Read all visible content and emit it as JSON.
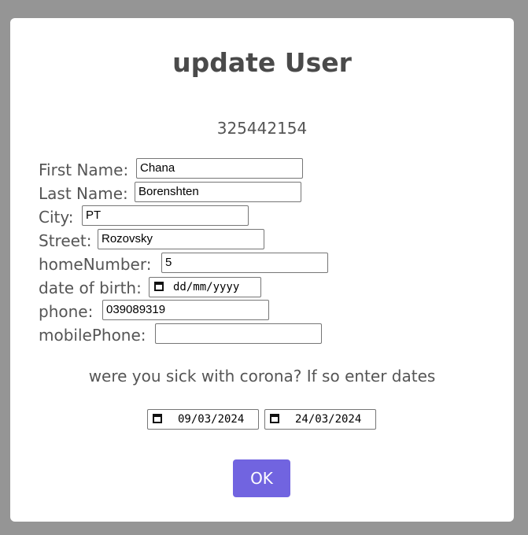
{
  "dialog": {
    "title": "update User",
    "user_id": "325442154",
    "fields": [
      {
        "label": "First Name:",
        "value": "Chana"
      },
      {
        "label": "Last Name:",
        "value": "Borenshten"
      },
      {
        "label": "City:",
        "value": "PT"
      },
      {
        "label": "Street:",
        "value": "Rozovsky"
      },
      {
        "label": "homeNumber:",
        "value": "5"
      },
      {
        "label": "date of birth:",
        "value": "dd/mm/yyyy"
      },
      {
        "label": "phone:",
        "value": "039089319"
      },
      {
        "label": "mobilePhone:",
        "value": ""
      }
    ],
    "corona_question": "were you sick with corona? If so enter dates",
    "corona_dates": {
      "from": "09/03/2024",
      "to": "24/03/2024"
    },
    "ok_label": "OK"
  },
  "colors": {
    "overlay": "#959595",
    "dialog_bg": "#ffffff",
    "button": "#7164e0",
    "text": "#555555"
  },
  "icons": {
    "date_picker": "calendar-icon"
  }
}
